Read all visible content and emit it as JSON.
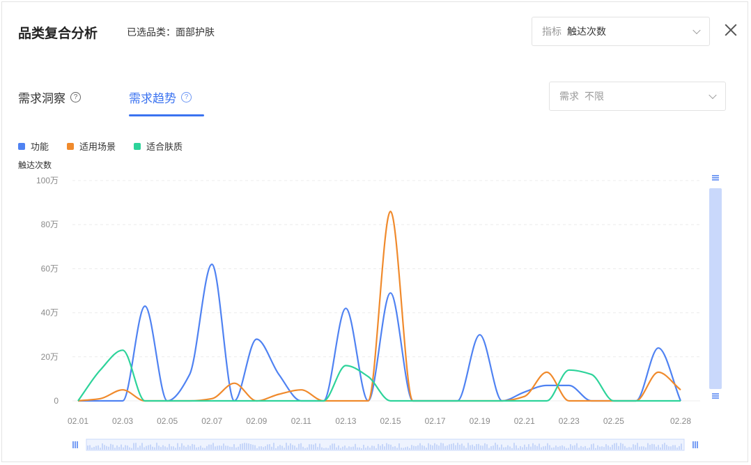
{
  "header": {
    "title": "品类复合分析",
    "selected_category": "已选品类：面部护肤"
  },
  "metric_select": {
    "label": "指标",
    "value": "触达次数"
  },
  "demand_select": {
    "label": "需求",
    "value": "不限"
  },
  "tabs": [
    {
      "label": "需求洞察",
      "active": false
    },
    {
      "label": "需求趋势",
      "active": true
    }
  ],
  "colors": {
    "accent": "#3b73f0",
    "series_1": "#4f82f2",
    "series_2": "#f08a2c",
    "series_3": "#2dd39a",
    "grid": "#ececec",
    "zoom_fill": "#c9d8fb"
  },
  "chart_data": {
    "type": "line",
    "ylabel": "触达次数",
    "ylim": [
      0,
      1000000
    ],
    "yticks": [
      {
        "value": 0,
        "label": "0"
      },
      {
        "value": 200000,
        "label": "20万"
      },
      {
        "value": 400000,
        "label": "40万"
      },
      {
        "value": 600000,
        "label": "60万"
      },
      {
        "value": 800000,
        "label": "80万"
      },
      {
        "value": 1000000,
        "label": "100万"
      }
    ],
    "x": [
      "02.01",
      "02.02",
      "02.03",
      "02.04",
      "02.05",
      "02.06",
      "02.07",
      "02.08",
      "02.09",
      "02.10",
      "02.11",
      "02.12",
      "02.13",
      "02.14",
      "02.15",
      "02.16",
      "02.17",
      "02.18",
      "02.19",
      "02.20",
      "02.21",
      "02.22",
      "02.23",
      "02.24",
      "02.25",
      "02.26",
      "02.27",
      "02.28"
    ],
    "xticks": [
      "02.01",
      "02.03",
      "02.05",
      "02.07",
      "02.09",
      "02.11",
      "02.13",
      "02.15",
      "02.17",
      "02.19",
      "02.21",
      "02.23",
      "02.25",
      "02.28"
    ],
    "series": [
      {
        "name": "功能",
        "values": [
          0,
          0,
          0,
          430000,
          0,
          120000,
          620000,
          0,
          280000,
          120000,
          0,
          0,
          420000,
          0,
          490000,
          0,
          0,
          0,
          300000,
          0,
          40000,
          70000,
          70000,
          0,
          0,
          0,
          240000,
          0
        ]
      },
      {
        "name": "适用场景",
        "values": [
          0,
          10000,
          50000,
          0,
          0,
          0,
          10000,
          80000,
          0,
          30000,
          50000,
          0,
          0,
          0,
          860000,
          0,
          0,
          0,
          0,
          0,
          20000,
          130000,
          0,
          0,
          0,
          0,
          130000,
          50000
        ]
      },
      {
        "name": "适合肤质",
        "values": [
          0,
          140000,
          230000,
          0,
          0,
          0,
          0,
          0,
          0,
          0,
          0,
          0,
          160000,
          110000,
          0,
          0,
          0,
          0,
          0,
          0,
          0,
          0,
          140000,
          120000,
          0,
          0,
          0,
          0
        ]
      }
    ],
    "legend_position": "top-left",
    "grid": true
  }
}
